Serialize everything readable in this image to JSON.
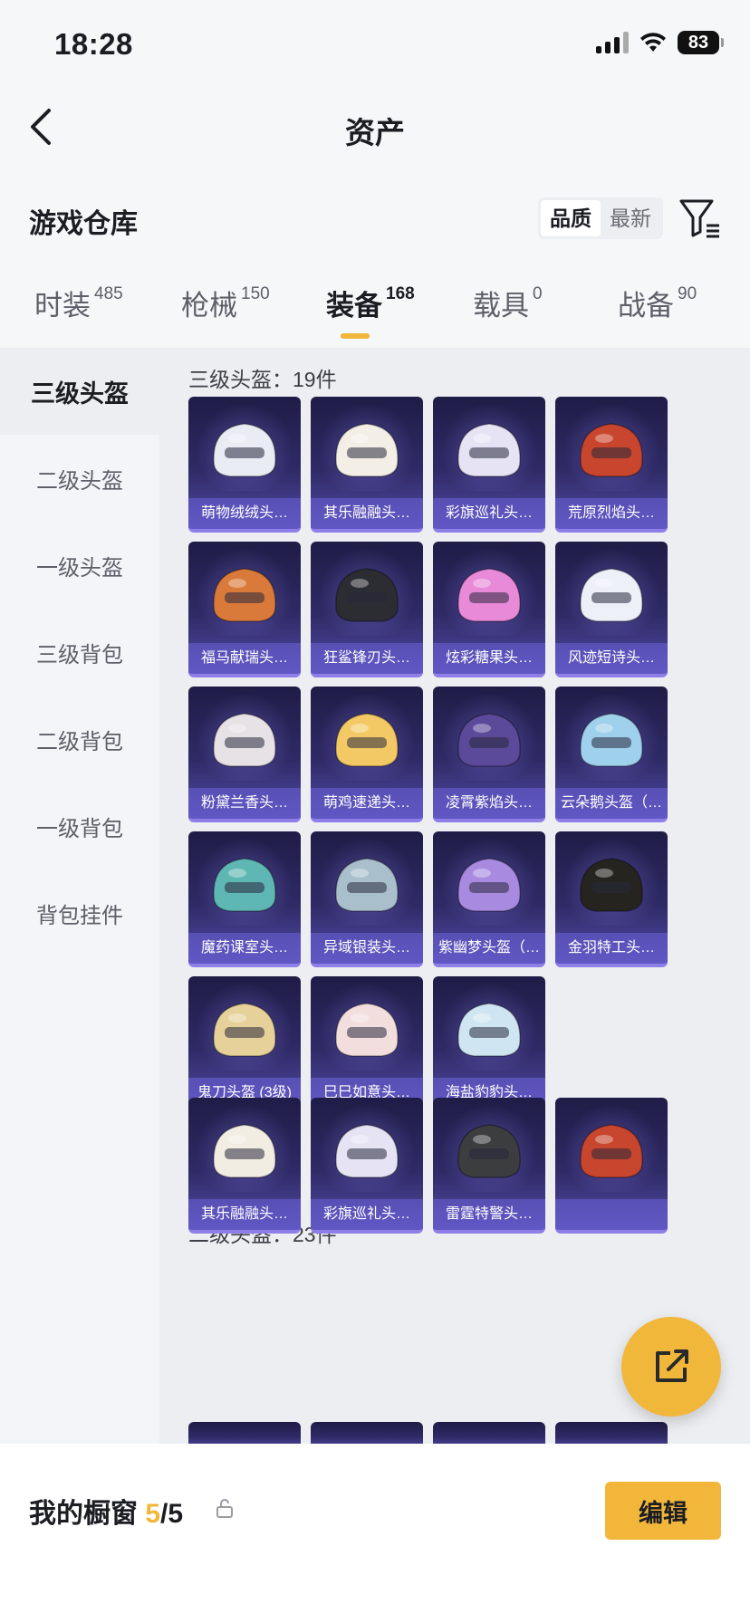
{
  "status": {
    "time": "18:28",
    "battery": "83"
  },
  "nav": {
    "title": "资产"
  },
  "warehouse": {
    "title": "游戏仓库",
    "sort_options": [
      "品质",
      "最新"
    ],
    "sort_selected": "品质"
  },
  "tabs": [
    {
      "label": "时装",
      "count": "485",
      "active": false
    },
    {
      "label": "枪械",
      "count": "150",
      "active": false
    },
    {
      "label": "装备",
      "count": "168",
      "active": true
    },
    {
      "label": "载具",
      "count": "0",
      "active": false
    },
    {
      "label": "战备",
      "count": "90",
      "active": false
    }
  ],
  "sidebar": {
    "items": [
      "三级头盔",
      "二级头盔",
      "一级头盔",
      "三级背包",
      "二级背包",
      "一级背包",
      "背包挂件"
    ],
    "active": "三级头盔"
  },
  "sections": [
    {
      "title": "三级头盔：19件",
      "items": [
        {
          "name": "萌物绒绒头…",
          "icon": "white-bunny-helmet-icon",
          "color": "#e9ecf3"
        },
        {
          "name": "其乐融融头…",
          "icon": "white-gold-visor-helmet-icon",
          "color": "#f3efe7"
        },
        {
          "name": "彩旗巡礼头…",
          "icon": "jester-helmet-icon",
          "color": "#e6e4f4"
        },
        {
          "name": "荒原烈焰头…",
          "icon": "red-dragon-helmet-icon",
          "color": "#c8452e"
        },
        {
          "name": "福马献瑞头…",
          "icon": "orange-horse-helmet-icon",
          "color": "#d97a3a"
        },
        {
          "name": "狂鲨锋刃头…",
          "icon": "black-shark-helmet-icon",
          "color": "#2c2c33"
        },
        {
          "name": "炫彩糖果头…",
          "icon": "pink-candy-helmet-icon",
          "color": "#e98ad8"
        },
        {
          "name": "风迹短诗头…",
          "icon": "lace-helmet-icon",
          "color": "#eef0f8"
        },
        {
          "name": "粉黛兰香头…",
          "icon": "red-visor-helmet-icon",
          "color": "#e6e2e6"
        },
        {
          "name": "萌鸡速递头…",
          "icon": "yellow-chick-helmet-icon",
          "color": "#f3c966"
        },
        {
          "name": "凌霄紫焰头…",
          "icon": "purple-flame-helmet-icon",
          "color": "#5b4a9a"
        },
        {
          "name": "云朵鹅头盔（…",
          "icon": "cloud-goose-helmet-icon",
          "color": "#9fd0ec"
        },
        {
          "name": "魔药课室头…",
          "icon": "witch-hat-helmet-icon",
          "color": "#5fb7b3"
        },
        {
          "name": "异域银装头…",
          "icon": "silver-armor-helmet-icon",
          "color": "#a9c0cc"
        },
        {
          "name": "紫幽梦头盔（…",
          "icon": "violet-dream-helmet-icon",
          "color": "#a88be0"
        },
        {
          "name": "金羽特工头…",
          "icon": "black-gold-helmet-icon",
          "color": "#25241f"
        },
        {
          "name": "鬼刀头盔 (3级)",
          "icon": "golden-winged-helmet-icon",
          "color": "#e6d19a"
        },
        {
          "name": "巳巳如意头…",
          "icon": "pink-snake-helmet-icon",
          "color": "#f3dede"
        },
        {
          "name": "海盐豹豹头…",
          "icon": "blue-leopard-helmet-icon",
          "color": "#cfe6f2"
        }
      ]
    },
    {
      "title": "二级头盔：23件",
      "items": [
        {
          "name": "其乐融融头…",
          "icon": "white-gold-helmet-icon",
          "color": "#f2ede2"
        },
        {
          "name": "彩旗巡礼头…",
          "icon": "jester-helmet-icon",
          "color": "#e6e4f4"
        },
        {
          "name": "雷霆特警头…",
          "icon": "swat-helmet-icon",
          "color": "#3b3d3f"
        },
        {
          "name": "",
          "icon": "red-helmet-icon",
          "color": "#c8452e"
        }
      ]
    }
  ],
  "bottom": {
    "showcase_label": "我的橱窗",
    "showcase_used": "5",
    "showcase_total": "/5",
    "edit_label": "编辑"
  }
}
